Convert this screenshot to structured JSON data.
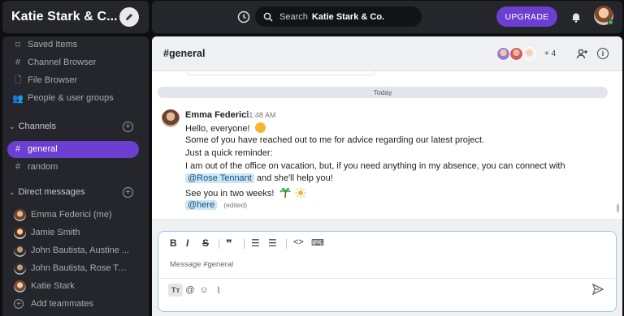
{
  "team": {
    "name": "Katie Stark & C..."
  },
  "topbar": {
    "search_label": "Search",
    "search_team": "Katie Stark & Co.",
    "upgrade": "UPGRADE"
  },
  "sidebar": {
    "nav": [
      {
        "label": "Saved Items",
        "icon": "bookmark-icon"
      },
      {
        "label": "Channel Browser",
        "icon": "hash-browser-icon"
      },
      {
        "label": "File Browser",
        "icon": "file-search-icon"
      },
      {
        "label": "People & user groups",
        "icon": "people-icon"
      }
    ],
    "channels_title": "Channels",
    "channels": [
      {
        "label": "general",
        "active": true
      },
      {
        "label": "random",
        "active": false
      }
    ],
    "dms_title": "Direct messages",
    "dms": [
      {
        "label": "Emma Federici (me)"
      },
      {
        "label": "Jamie Smith"
      },
      {
        "label": "John Bautista, Austine ..."
      },
      {
        "label": "John Bautista, Rose Ten..."
      },
      {
        "label": "Katie Stark"
      }
    ],
    "add_teammates": "Add teammates"
  },
  "channel": {
    "title": "#general",
    "member_count": "+ 4",
    "divider": "Today"
  },
  "message": {
    "author": "Emma Federici",
    "time": "11:48 AM",
    "line1": "Hello, everyone!",
    "line2": "Some of you have reached out to me for advice regarding our latest project.",
    "line3": "Just a quick reminder:",
    "line4": "I am out of the office on vacation, but, if you need anything in my absence, you can connect with",
    "mention1": "@Rose Tennant",
    "line5_rest": "and she'll help you!",
    "line6": "See you in two weeks!",
    "mention2": "@here",
    "edited": "(edited)"
  },
  "composer": {
    "placeholder": "Message #general",
    "tt": "Tт"
  },
  "colors": {
    "accent": "#6b3fd1",
    "mention_bg": "#cbe6f7"
  }
}
